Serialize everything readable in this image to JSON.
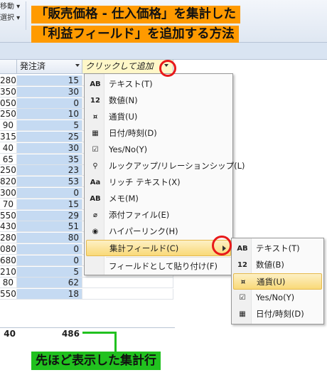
{
  "ribbon": {
    "items": [
      "移動 ▾",
      "選択 ▾"
    ]
  },
  "banner": {
    "line1": "「販売価格 - 仕入価格」を集計した",
    "line2": "「利益フィールド」を追加する方法",
    "color": "#ff9a00"
  },
  "table": {
    "headers": [
      "",
      "発注済",
      "クリックして追加"
    ],
    "rows": [
      [
        "280",
        "15",
        ""
      ],
      [
        "350",
        "30",
        ""
      ],
      [
        "050",
        "0",
        ""
      ],
      [
        "250",
        "10",
        ""
      ],
      [
        "90",
        "5",
        ""
      ],
      [
        "315",
        "25",
        ""
      ],
      [
        "40",
        "30",
        ""
      ],
      [
        "65",
        "35",
        ""
      ],
      [
        "250",
        "23",
        ""
      ],
      [
        "820",
        "53",
        ""
      ],
      [
        "300",
        "0",
        ""
      ],
      [
        "70",
        "15",
        ""
      ],
      [
        "550",
        "29",
        ""
      ],
      [
        "430",
        "51",
        ""
      ],
      [
        "280",
        "80",
        ""
      ],
      [
        "080",
        "0",
        ""
      ],
      [
        "680",
        "0",
        ""
      ],
      [
        "210",
        "5",
        ""
      ],
      [
        "80",
        "62",
        ""
      ],
      [
        "550",
        "18",
        ""
      ]
    ],
    "total_left": "40",
    "total_value": "486"
  },
  "menu": {
    "items": [
      {
        "icon": "AB",
        "icon_name": "text-type-icon",
        "label": "テキスト(T)"
      },
      {
        "icon": "12",
        "icon_name": "number-type-icon",
        "label": "数値(N)"
      },
      {
        "icon": "¤",
        "icon_name": "currency-type-icon",
        "label": "通貨(U)"
      },
      {
        "icon": "▦",
        "icon_name": "date-time-type-icon",
        "label": "日付/時刻(D)"
      },
      {
        "icon": "☑",
        "icon_name": "yes-no-type-icon",
        "label": "Yes/No(Y)"
      },
      {
        "icon": "⚲",
        "icon_name": "lookup-relationship-icon",
        "label": "ルックアップ/リレーションシップ(L)"
      },
      {
        "icon": "Aa",
        "icon_name": "rich-text-icon",
        "label": "リッチ テキスト(X)"
      },
      {
        "icon": "AB",
        "icon_name": "memo-type-icon",
        "label": "メモ(M)"
      },
      {
        "icon": "⌀",
        "icon_name": "attachment-icon",
        "label": "添付ファイル(E)"
      },
      {
        "icon": "◉",
        "icon_name": "hyperlink-icon",
        "label": "ハイパーリンク(H)"
      },
      {
        "icon": "",
        "icon_name": "",
        "label": "集計フィールド(C)"
      },
      {
        "icon": "",
        "icon_name": "",
        "label": "フィールドとして貼り付け(F)"
      }
    ]
  },
  "submenu": {
    "items": [
      {
        "icon": "AB",
        "icon_name": "text-type-icon",
        "label": "テキスト(T)"
      },
      {
        "icon": "12",
        "icon_name": "number-type-icon",
        "label": "数値(B)"
      },
      {
        "icon": "¤",
        "icon_name": "currency-type-icon",
        "label": "通貨(U)"
      },
      {
        "icon": "☑",
        "icon_name": "yes-no-type-icon",
        "label": "Yes/No(Y)"
      },
      {
        "icon": "▦",
        "icon_name": "date-time-type-icon",
        "label": "日付/時刻(D)"
      }
    ]
  },
  "callout": {
    "text": "先ほど表示した集計行",
    "color": "#21c11f"
  },
  "highlight_color": "#e8191a"
}
